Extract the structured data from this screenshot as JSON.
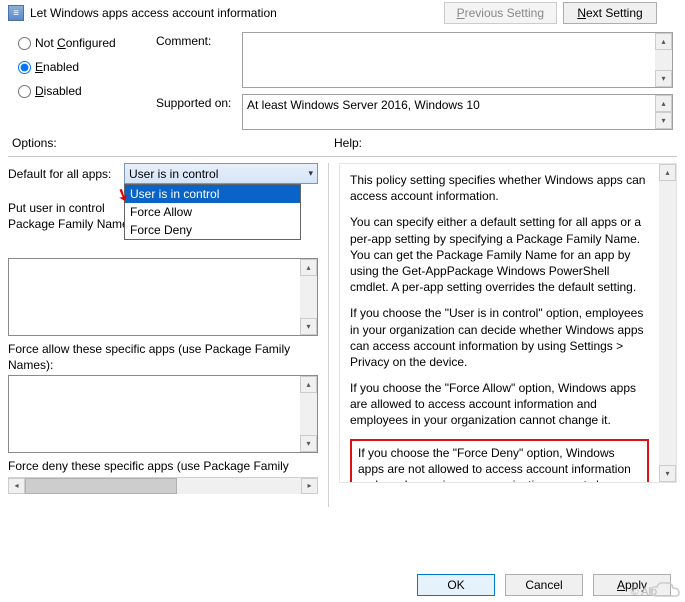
{
  "titlebar": {
    "title": "Let Windows apps access account information",
    "prev_label": "Previous Setting",
    "next_label": "Next Setting"
  },
  "state": {
    "not_configured": "Not Configured",
    "enabled": "Enabled",
    "disabled": "Disabled",
    "comment_label": "Comment:",
    "comment_value": "",
    "supported_label": "Supported on:",
    "supported_value": "At least Windows Server 2016, Windows 10"
  },
  "sections": {
    "options": "Options:",
    "help": "Help:"
  },
  "options": {
    "default_label": "Default for all apps:",
    "default_value": "User is in control",
    "default_items": [
      "User is in control",
      "Force Allow",
      "Force Deny"
    ],
    "put_user_label": "Put user in control",
    "pfn_label": "Package Family Name",
    "force_allow_label": "Force allow these specific apps (use Package Family Names):",
    "force_deny_label": "Force deny these specific apps (use Package Family"
  },
  "help": {
    "p1": "This policy setting specifies whether Windows apps can access account information.",
    "p2": "You can specify either a default setting for all apps or a per-app setting by specifying a Package Family Name. You can get the Package Family Name for an app by using the Get-AppPackage Windows PowerShell cmdlet. A per-app setting overrides the default setting.",
    "p3": "If you choose the \"User is in control\" option, employees in your organization can decide whether Windows apps can access account information by using Settings > Privacy on the device.",
    "p4": "If you choose the \"Force Allow\" option, Windows apps are allowed to access account information and employees in your organization cannot change it.",
    "p5": "If you choose the \"Force Deny\" option, Windows apps are not allowed to access account information and employees in your organization cannot change it."
  },
  "footer": {
    "ok": "OK",
    "cancel": "Cancel",
    "apply": "Apply"
  },
  "watermark": "© Alb",
  "brand": "亿速云",
  "underline": {
    "p": "P",
    "n": "N",
    "c": "C",
    "e": "E",
    "d": "D",
    "a": "A"
  }
}
